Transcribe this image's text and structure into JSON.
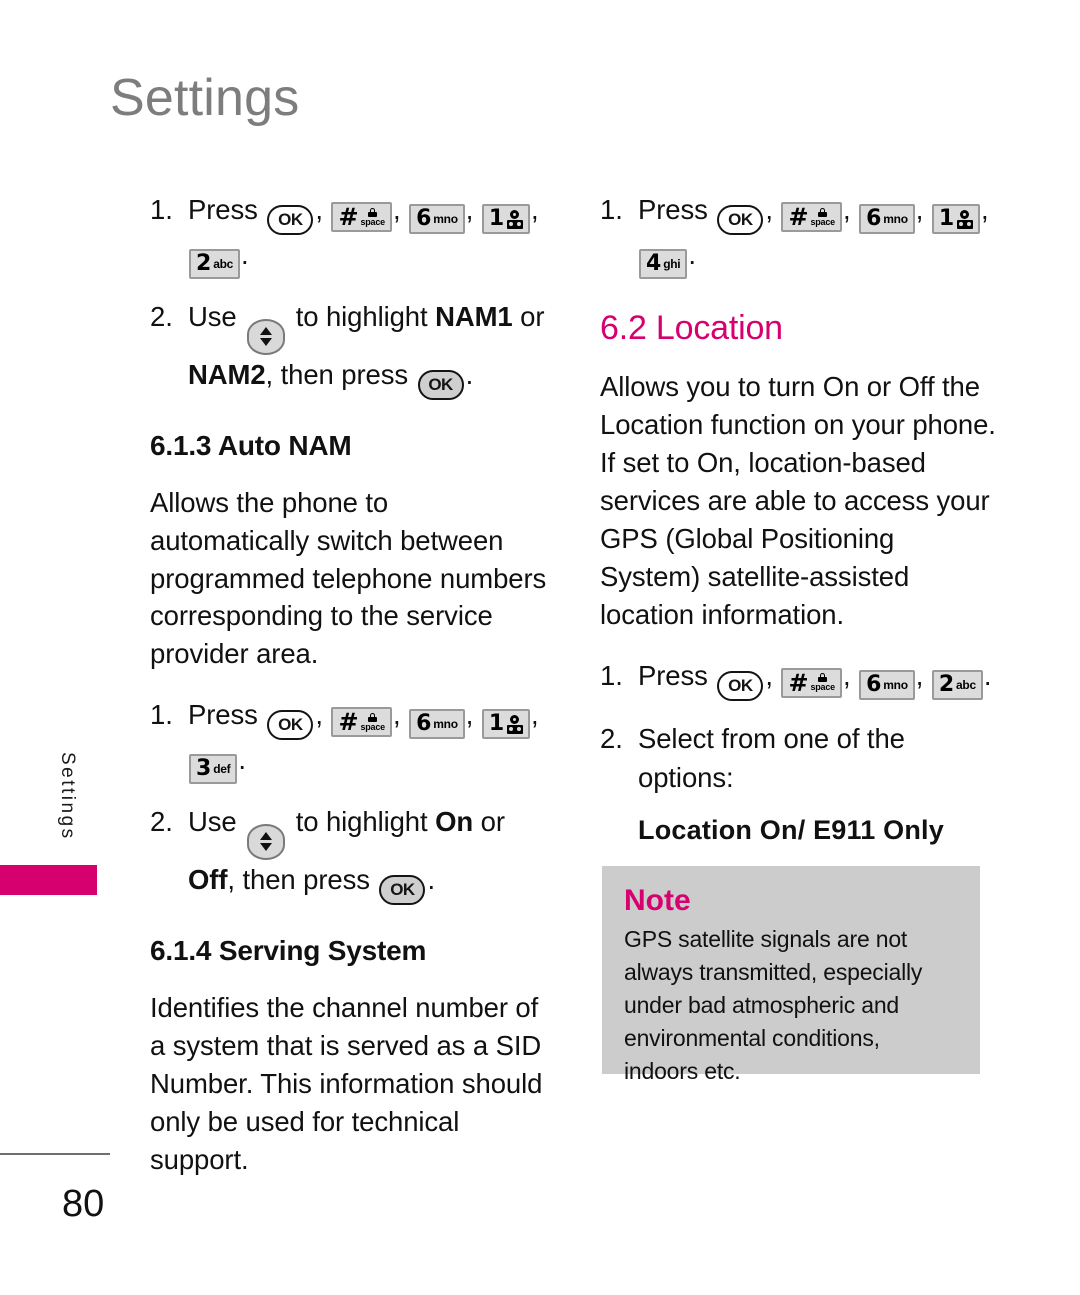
{
  "page": {
    "title": "Settings",
    "side_tab_label": "Settings",
    "number": "80"
  },
  "colors": {
    "accent_magenta": "#d6006e",
    "title_grey": "#7d7d7d",
    "note_bg": "#cccccc",
    "key_face": "#dcdcdc",
    "key_border": "#9a9a9a"
  },
  "keys": {
    "ok": "OK",
    "hash": {
      "symbol": "#",
      "sub": "space",
      "icon": "lock-icon"
    },
    "six": {
      "digit": "6",
      "sub": "mno"
    },
    "one": {
      "digit": "1",
      "icon": "voicemail-icon"
    },
    "two": {
      "digit": "2",
      "sub": "abc"
    },
    "three": {
      "digit": "3",
      "sub": "def"
    },
    "four": {
      "digit": "4",
      "sub": "ghi"
    },
    "nav": "up-down-navigation-key"
  },
  "left_column": {
    "step1": {
      "num": "1.",
      "verb": "Press",
      "comma": ",",
      "period": "."
    },
    "step2": {
      "num": "2.",
      "verb": "Use",
      "mid": "to highlight",
      "option_a": "NAM1",
      "or": "or",
      "option_b": "NAM2",
      "tail": ", then press",
      "period": "."
    },
    "section_auto_nam": {
      "heading": "6.1.3 Auto NAM",
      "body": "Allows the phone to automatically switch between programmed telephone numbers corresponding to the service provider area."
    },
    "step3": {
      "num": "1.",
      "verb": "Press",
      "comma": ",",
      "period": "."
    },
    "step4": {
      "num": "2.",
      "verb": "Use",
      "mid": "to highlight",
      "option_a": "On",
      "or": "or",
      "option_b": "Off",
      "tail": ", then press",
      "period": "."
    },
    "section_serving_system": {
      "heading": "6.1.4 Serving System",
      "body": "Identifies the channel number of a system that is served as a SID Number. This information should only be used for technical support."
    }
  },
  "right_column": {
    "step1": {
      "num": "1.",
      "verb": "Press",
      "comma": ",",
      "period": "."
    },
    "section_location": {
      "heading": "6.2 Location",
      "body": "Allows you to turn On or Off the Location function on your phone. If set to On, location-based services are able to access your GPS (Global Positioning System) satellite-assisted location information."
    },
    "step2": {
      "num": "1.",
      "verb": "Press",
      "comma": ",",
      "period": "."
    },
    "step3": {
      "num": "2.",
      "text": "Select from one of the options:"
    },
    "options_line": "Location On/ E911  Only",
    "note": {
      "title": "Note",
      "body": "GPS satellite signals are not always transmitted, especially under bad atmospheric and environmental conditions, indoors etc."
    }
  }
}
